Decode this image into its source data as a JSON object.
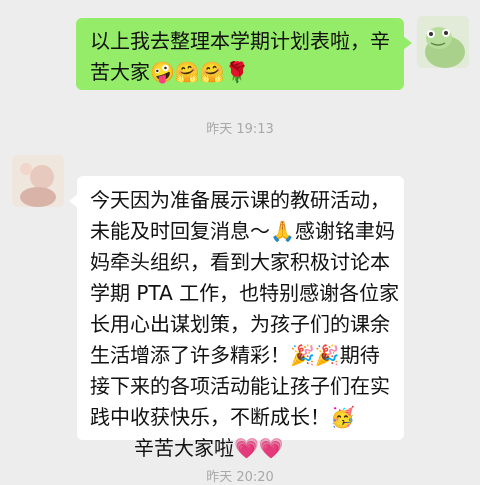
{
  "messages": [
    {
      "sender": "self",
      "lines": [
        "以上我去整理本学期计划表啦，辛",
        "苦大家🤪🤗🤗🌹"
      ]
    },
    {
      "sender": "peer",
      "name": "",
      "lines": [
        "今天因为准备展示课的教研活动，",
        "未能及时回复消息～🙏感谢铭聿妈",
        "妈牵头组织，看到大家积极讨论本",
        "学期 PTA 工作，也特别感谢各位家",
        "长用心出谋划策，为孩子们的课余",
        "生活增添了许多精彩！🎉🎉期待",
        "接下来的各项活动能让孩子们在实",
        "践中收获快乐，不断成长！🥳",
        "辛苦大家啦💗💗"
      ]
    }
  ],
  "timestamps": [
    "昨天 19:13",
    "昨天 20:20"
  ]
}
